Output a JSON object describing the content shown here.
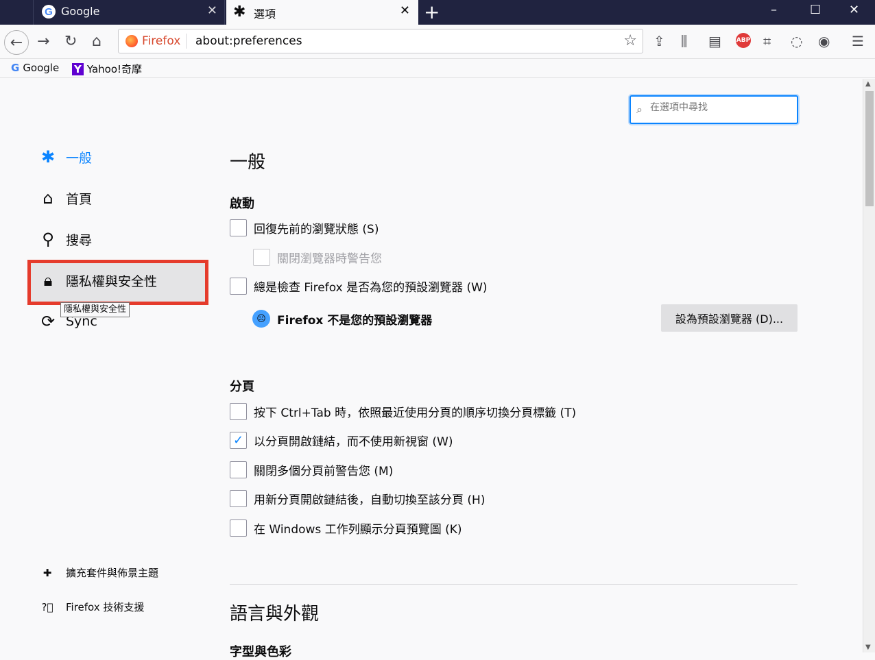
{
  "tabs": [
    {
      "label": "Google"
    },
    {
      "label": "選項"
    }
  ],
  "window": {
    "minimize": "–",
    "maximize": "☐",
    "close": "✕",
    "new_tab": "+"
  },
  "urlbar": {
    "identity": "Firefox",
    "url": "about:preferences"
  },
  "bookmarks": [
    {
      "icon": "G",
      "label": "Google"
    },
    {
      "icon": "Y",
      "label": "Yahoo!奇摩"
    }
  ],
  "search": {
    "placeholder": "在選項中尋找"
  },
  "sidebar": {
    "items": [
      {
        "label": "一般"
      },
      {
        "label": "首頁"
      },
      {
        "label": "搜尋"
      },
      {
        "label": "隱私權與安全性"
      },
      {
        "label": "Sync"
      }
    ],
    "tooltip": "隱私權與安全性",
    "footer": [
      {
        "label": "擴充套件與佈景主題"
      },
      {
        "label": "Firefox 技術支援"
      }
    ]
  },
  "main": {
    "title": "一般",
    "startup": {
      "heading": "啟動",
      "restore": "回復先前的瀏覽狀態 (S)",
      "warn_quit": "關閉瀏覽器時警告您",
      "check_default": "總是檢查 Firefox 是否為您的預設瀏覽器 (W)",
      "not_default": "Firefox 不是您的預設瀏覽器",
      "make_default_button": "設為預設瀏覽器 (D)..."
    },
    "tabs_section": {
      "heading": "分頁",
      "items": [
        {
          "label": "按下 Ctrl+Tab 時，依照最近使用分頁的順序切換分頁標籤 (T)",
          "checked": false
        },
        {
          "label": "以分頁開啟鏈結，而不使用新視窗 (W)",
          "checked": true
        },
        {
          "label": "關閉多個分頁前警告您 (M)",
          "checked": false
        },
        {
          "label": "用新分頁開啟鏈結後，自動切換至該分頁 (H)",
          "checked": false
        },
        {
          "label": "在 Windows 工作列顯示分頁預覽圖 (K)",
          "checked": false
        }
      ]
    },
    "language_heading": "語言與外觀",
    "fonts_heading": "字型與色彩"
  },
  "colors": {
    "accent": "#0a84ff",
    "highlight_box": "#e53b2c",
    "tabbar": "#202340"
  }
}
